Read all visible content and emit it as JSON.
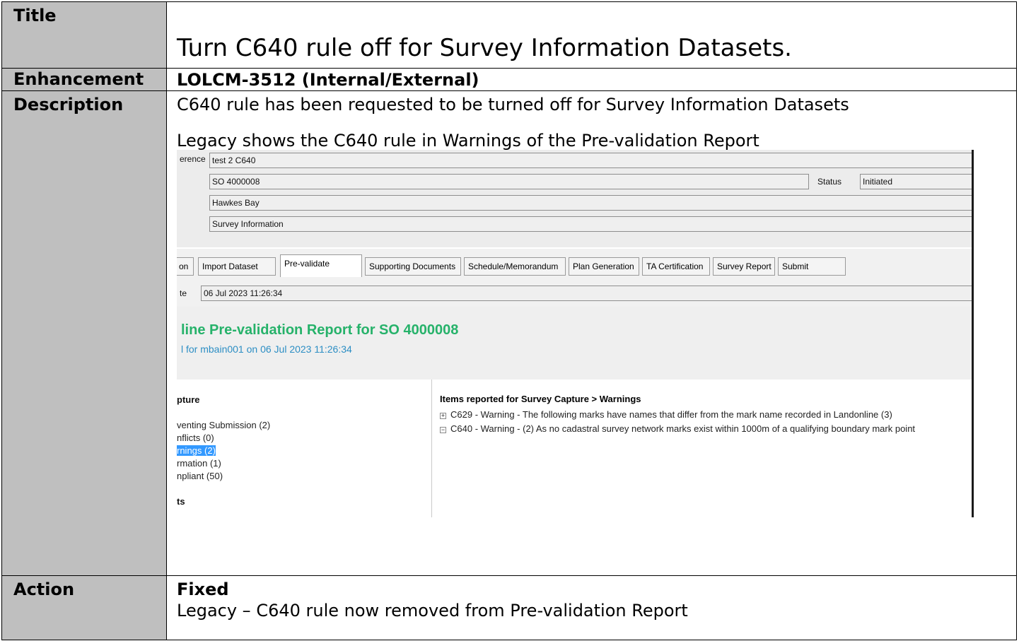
{
  "table": {
    "title_label": "Title",
    "title_value": "Turn C640 rule off for Survey Information Datasets.",
    "enhancement_label": "Enhancement",
    "enhancement_value": "LOLCM-3512 (Internal/External)",
    "description_label": "Description",
    "description_line1": "C640 rule has been requested to be turned off for Survey Information Datasets",
    "description_line2": "Legacy shows the C640 rule in Warnings of the Pre-validation Report",
    "action_label": "Action",
    "action_status": "Fixed",
    "action_text": "Legacy – C640 rule now removed from Pre-validation Report"
  },
  "screenshot": {
    "field_label_ref": "erence",
    "field_label_date": "te",
    "reference_value": "test 2 C640",
    "survey_value": "SO 4000008",
    "status_label": "Status",
    "status_value": "Initiated",
    "region_value": "Hawkes Bay",
    "type_value": "Survey Information",
    "tabs": [
      "on",
      "Import Dataset",
      "Pre-validate",
      "Supporting Documents",
      "Schedule/Memorandum",
      "Plan Generation",
      "TA Certification",
      "Survey Report",
      "Submit"
    ],
    "date_value": "06 Jul 2023 11:26:34",
    "report_title": "line Pre-validation Report for SO 4000008",
    "report_subtitle": "l for mbain001 on 06 Jul 2023 11:26:34",
    "tree_heading": "pture",
    "tree_items": [
      "venting Submission (2)",
      "nflicts (0)",
      "rnings (2)",
      "rmation (1)",
      "npliant (50)"
    ],
    "tree_heading2": "ts",
    "right_heading": "Items reported for Survey Capture > Warnings",
    "warn_icon_plus": "+",
    "warn_icon_minus": "−",
    "warning1": "C629 - Warning - The following marks have names that differ from the mark name recorded in Landonline (3)",
    "warning2": "C640 - Warning - (2) As no cadastral survey network marks exist within 1000m of a qualifying boundary mark point"
  }
}
